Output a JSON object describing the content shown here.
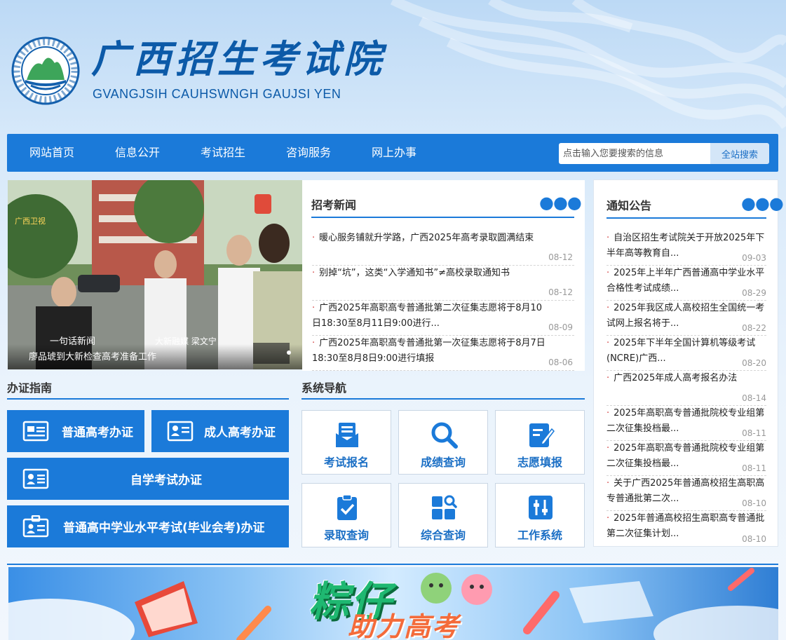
{
  "header": {
    "title": "广西招生考试院",
    "subtitle": "GVANGJSIH CAUHSWNGH GAUJSI YEN",
    "logo_ring_text": "广西招生考试院 GVANGJSIH CAUHSWNGH GAUJSI YEN"
  },
  "nav": {
    "items": [
      "网站首页",
      "信息公开",
      "考试招生",
      "咨询服务",
      "网上办事"
    ],
    "search_placeholder": "点击输入您要搜索的信息",
    "search_button": "全站搜索"
  },
  "slider": {
    "caption": "廖品琥到大新检查高考准备工作",
    "video_lower_third": "一句话新闻",
    "video_credit": "大新融媒  梁文宁",
    "video_logo": "广西卫视"
  },
  "news": {
    "title": "招考新闻",
    "items": [
      {
        "text": "暖心服务铺就升学路，广西2025年高考录取圆满结束",
        "date": "08-12"
      },
      {
        "text": "别掉“坑”，这类“入学通知书”≠高校录取通知书",
        "date": "08-12"
      },
      {
        "text": "广西2025年高职高专普通批第二次征集志愿将于8月10日18:30至8月11日9:00进行...",
        "date": "08-09"
      },
      {
        "text": "广西2025年高职高专普通批第一次征集志愿将于8月7日18:30至8月8日9:00进行填报",
        "date": "08-06"
      }
    ]
  },
  "notice": {
    "title": "通知公告",
    "items": [
      {
        "text": "自治区招生考试院关于开放2025年下半年高等教育自...",
        "date": "09-03"
      },
      {
        "text": "2025年上半年广西普通高中学业水平合格性考试成绩...",
        "date": "08-29"
      },
      {
        "text": "2025年我区成人高校招生全国统一考试网上报名将于...",
        "date": "08-22"
      },
      {
        "text": "2025年下半年全国计算机等级考试(NCRE)广西...",
        "date": "08-20"
      },
      {
        "text": "广西2025年成人高考报名办法",
        "date": "08-14"
      },
      {
        "text": "2025年高职高专普通批院校专业组第二次征集投档最...",
        "date": "08-11"
      },
      {
        "text": "2025年高职高专普通批院校专业组第二次征集投档最...",
        "date": "08-11"
      },
      {
        "text": "关于广西2025年普通高校招生高职高专普通批第二次...",
        "date": "08-10"
      },
      {
        "text": "2025年普通高校招生高职高专普通批第二次征集计划...",
        "date": "08-10"
      }
    ]
  },
  "guide": {
    "title": "办证指南",
    "buttons": [
      "普通高考办证",
      "成人高考办证",
      "自学考试办证",
      "普通高中学业水平考试(毕业会考)办证"
    ]
  },
  "sysnav": {
    "title": "系统导航",
    "items": [
      {
        "label": "考试报名",
        "icon": "exam-registration-icon"
      },
      {
        "label": "成绩查询",
        "icon": "search-icon"
      },
      {
        "label": "志愿填报",
        "icon": "edit-form-icon"
      },
      {
        "label": "录取查询",
        "icon": "clipboard-check-icon"
      },
      {
        "label": "综合查询",
        "icon": "grid-search-icon"
      },
      {
        "label": "工作系统",
        "icon": "sliders-icon"
      }
    ]
  },
  "banner": {
    "title1": "粽仔",
    "title2": "助力高考"
  },
  "colors": {
    "primary": "#1b7ad9",
    "title_blue": "#0c5aa8",
    "bullet_red": "#d23b3b"
  }
}
